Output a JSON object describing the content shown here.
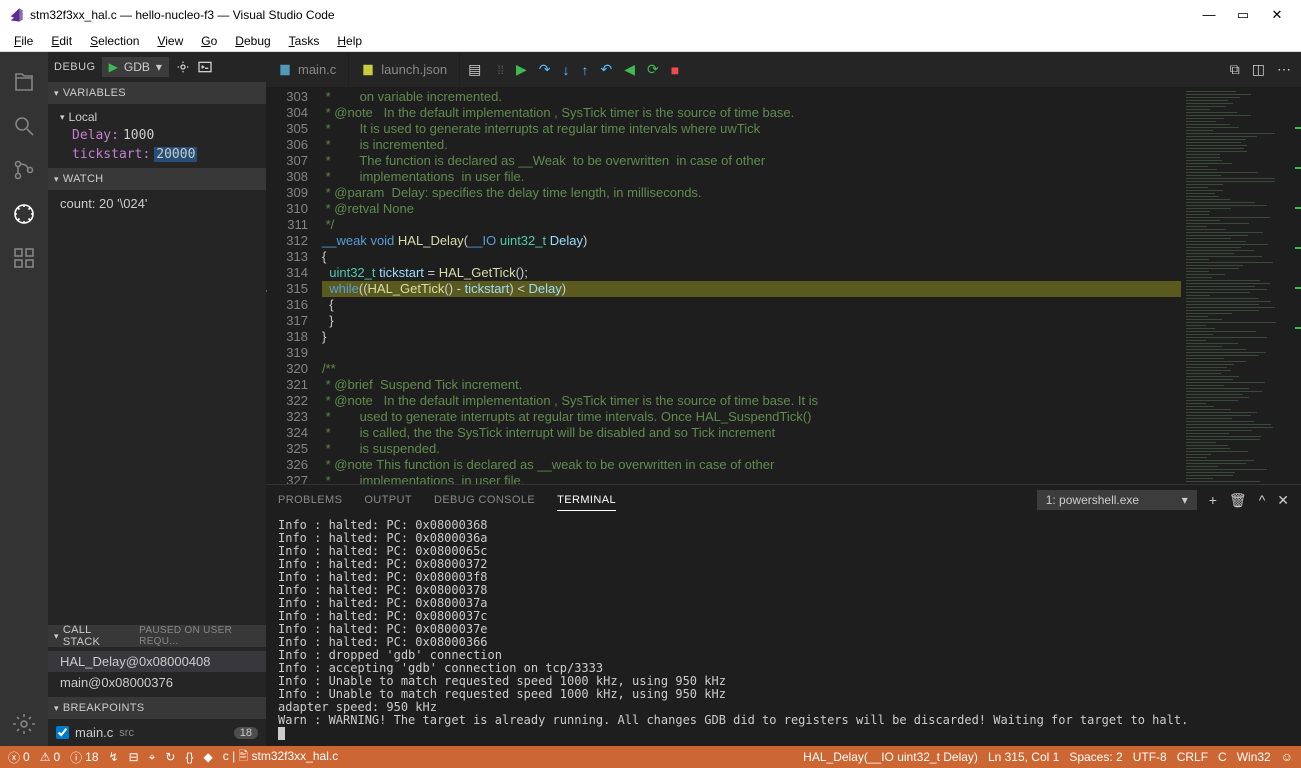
{
  "title": "stm32f3xx_hal.c — hello-nucleo-f3 — Visual Studio Code",
  "menu": [
    "File",
    "Edit",
    "Selection",
    "View",
    "Go",
    "Debug",
    "Tasks",
    "Help"
  ],
  "debug": {
    "label": "DEBUG",
    "config": "GDB"
  },
  "variables": {
    "hdr": "VARIABLES",
    "scope": "Local",
    "items": [
      {
        "name": "Delay:",
        "value": "1000"
      },
      {
        "name": "tickstart:",
        "value": "20000",
        "selected": true
      }
    ]
  },
  "watch": {
    "hdr": "WATCH",
    "expr": "count: 20 '\\024'"
  },
  "callstack": {
    "hdr": "CALL STACK",
    "status": "PAUSED ON USER REQU...",
    "frames": [
      "HAL_Delay@0x08000408",
      "main@0x08000376"
    ]
  },
  "breakpoints": {
    "hdr": "BREAKPOINTS",
    "items": [
      {
        "file": "main.c",
        "src": "src",
        "line": "18"
      }
    ]
  },
  "tabs": {
    "open": [
      "main.c",
      "launch.json"
    ]
  },
  "editor": {
    "startLine": 303,
    "currentLine": 315,
    "lines": [
      {
        "t": " *        on variable incremented.",
        "c": "c-comment"
      },
      {
        "t": " * @note   In the default implementation , SysTick timer is the source of time base.",
        "c": "c-comment"
      },
      {
        "t": " *        It is used to generate interrupts at regular time intervals where uwTick",
        "c": "c-comment"
      },
      {
        "t": " *        is incremented.",
        "c": "c-comment"
      },
      {
        "t": " *        The function is declared as __Weak  to be overwritten  in case of other",
        "c": "c-comment"
      },
      {
        "t": " *        implementations  in user file.",
        "c": "c-comment"
      },
      {
        "t": " * @param  Delay: specifies the delay time length, in milliseconds.",
        "c": "c-comment"
      },
      {
        "t": " * @retval None",
        "c": "c-comment"
      },
      {
        "t": " */",
        "c": "c-comment"
      },
      {
        "html": "<span class='c-kw'>__weak</span> <span class='c-kw'>void</span> <span class='c-fn'>HAL_Delay</span>(<span class='c-kw'>__IO</span> <span class='c-type'>uint32_t</span> <span class='c-id'>Delay</span>)"
      },
      {
        "t": "{"
      },
      {
        "html": "  <span class='c-type'>uint32_t</span> <span class='c-id'>tickstart</span> = <span class='c-fn'>HAL_GetTick</span>();"
      },
      {
        "html": "  <span class='c-kw'>while</span>((<span class='c-fn'>HAL_GetTick</span>() - <span class='c-id'>tickstart</span>) &lt; <span class='c-id'>Delay</span>)",
        "hl": true
      },
      {
        "t": "  {"
      },
      {
        "t": "  }"
      },
      {
        "t": "}"
      },
      {
        "t": ""
      },
      {
        "t": "/**",
        "c": "c-comment"
      },
      {
        "t": " * @brief  Suspend Tick increment.",
        "c": "c-comment"
      },
      {
        "t": " * @note   In the default implementation , SysTick timer is the source of time base. It is",
        "c": "c-comment"
      },
      {
        "t": " *        used to generate interrupts at regular time intervals. Once HAL_SuspendTick()",
        "c": "c-comment"
      },
      {
        "t": " *        is called, the the SysTick interrupt will be disabled and so Tick increment",
        "c": "c-comment"
      },
      {
        "t": " *        is suspended.",
        "c": "c-comment"
      },
      {
        "t": " * @note This function is declared as __weak to be overwritten in case of other",
        "c": "c-comment"
      },
      {
        "t": " *        implementations  in user file.",
        "c": "c-comment"
      }
    ]
  },
  "panel": {
    "tabs": [
      "PROBLEMS",
      "OUTPUT",
      "DEBUG CONSOLE",
      "TERMINAL"
    ],
    "active": "TERMINAL",
    "termSelect": "1: powershell.exe",
    "terminal": [
      "Info : halted: PC: 0x08000368",
      "Info : halted: PC: 0x0800036a",
      "Info : halted: PC: 0x0800065c",
      "Info : halted: PC: 0x08000372",
      "Info : halted: PC: 0x080003f8",
      "Info : halted: PC: 0x08000378",
      "Info : halted: PC: 0x0800037a",
      "Info : halted: PC: 0x0800037c",
      "Info : halted: PC: 0x0800037e",
      "Info : halted: PC: 0x08000366",
      "Info : dropped 'gdb' connection",
      "Info : accepting 'gdb' connection on tcp/3333",
      "Info : Unable to match requested speed 1000 kHz, using 950 kHz",
      "Info : Unable to match requested speed 1000 kHz, using 950 kHz",
      "adapter speed: 950 kHz",
      "Warn : WARNING! The target is already running. All changes GDB did to registers will be discarded! Waiting for target to halt."
    ]
  },
  "status": {
    "errors": "0",
    "warnings": "0",
    "info": "18",
    "breadcrumb": "c | 🖹 stm32f3xx_hal.c",
    "fn": "HAL_Delay(__IO uint32_t Delay)",
    "pos": "Ln 315, Col 1",
    "spaces": "Spaces: 2",
    "enc": "UTF-8",
    "eol": "CRLF",
    "lang": "C",
    "os": "Win32"
  }
}
